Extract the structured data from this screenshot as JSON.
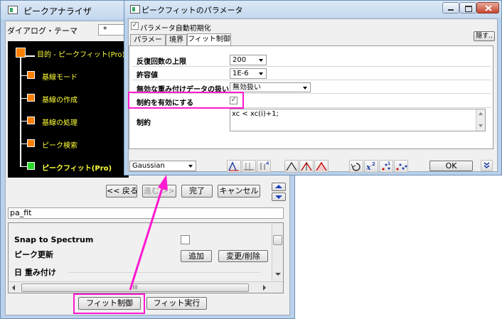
{
  "peak_analyzer": {
    "title": "ピークアナライザ",
    "theme_label": "ダイアログ・テーマ",
    "theme_value": "*",
    "flow": {
      "main_goal": "目的 - ピークフィット(Pro)",
      "steps": [
        {
          "label": "基線モード"
        },
        {
          "label": "基線の作成"
        },
        {
          "label": "基線の処理"
        },
        {
          "label": "ピーク検索"
        },
        {
          "label": "ピークフィット(Pro)"
        }
      ]
    },
    "nav": {
      "back": "<< 戻る",
      "next": "進む >>",
      "finish": "完了",
      "cancel": "キャンセル"
    },
    "name_value": "pa_fit",
    "panel": {
      "snap_label": "Snap to Spectrum",
      "peak_update_label": "ピーク更新",
      "add_button": "追加",
      "change_delete_button": "変更/削除",
      "weighting_label": "日 重み付け",
      "hscroll_grip": "III"
    },
    "bottom": {
      "fit_control": "フィット制御",
      "fit_run": "フィット実行"
    }
  },
  "dialog": {
    "title": "ピークフィットのパラメータ",
    "auto_init_label": "パラメータ自動初期化",
    "auto_init_checked": true,
    "hide_button": "隠す..",
    "tabs": [
      {
        "label": "パラメータ"
      },
      {
        "label": "境界"
      },
      {
        "label": "フィット制御"
      }
    ],
    "active_tab": 2,
    "rows": {
      "max_iter_label": "反復回数の上限",
      "max_iter_value": "200",
      "tolerance_label": "許容値",
      "tolerance_value": "1E-6",
      "invalid_weight_label": "無効な重み付けデータの扱い",
      "invalid_weight_value": "無効扱い",
      "enable_constraints_label": "制約を有効にする",
      "enable_constraints_checked": true,
      "constraints_label": "制約",
      "constraints_value": "xc < xc(i)+1;"
    },
    "function_select": "Gaussian",
    "ok_button": "OK"
  },
  "colors": {
    "highlight": "#ff19d0",
    "step_orange": "#ff7f00",
    "step_active_green": "#29d829",
    "flow_text_yellow": "#ffff3a"
  }
}
